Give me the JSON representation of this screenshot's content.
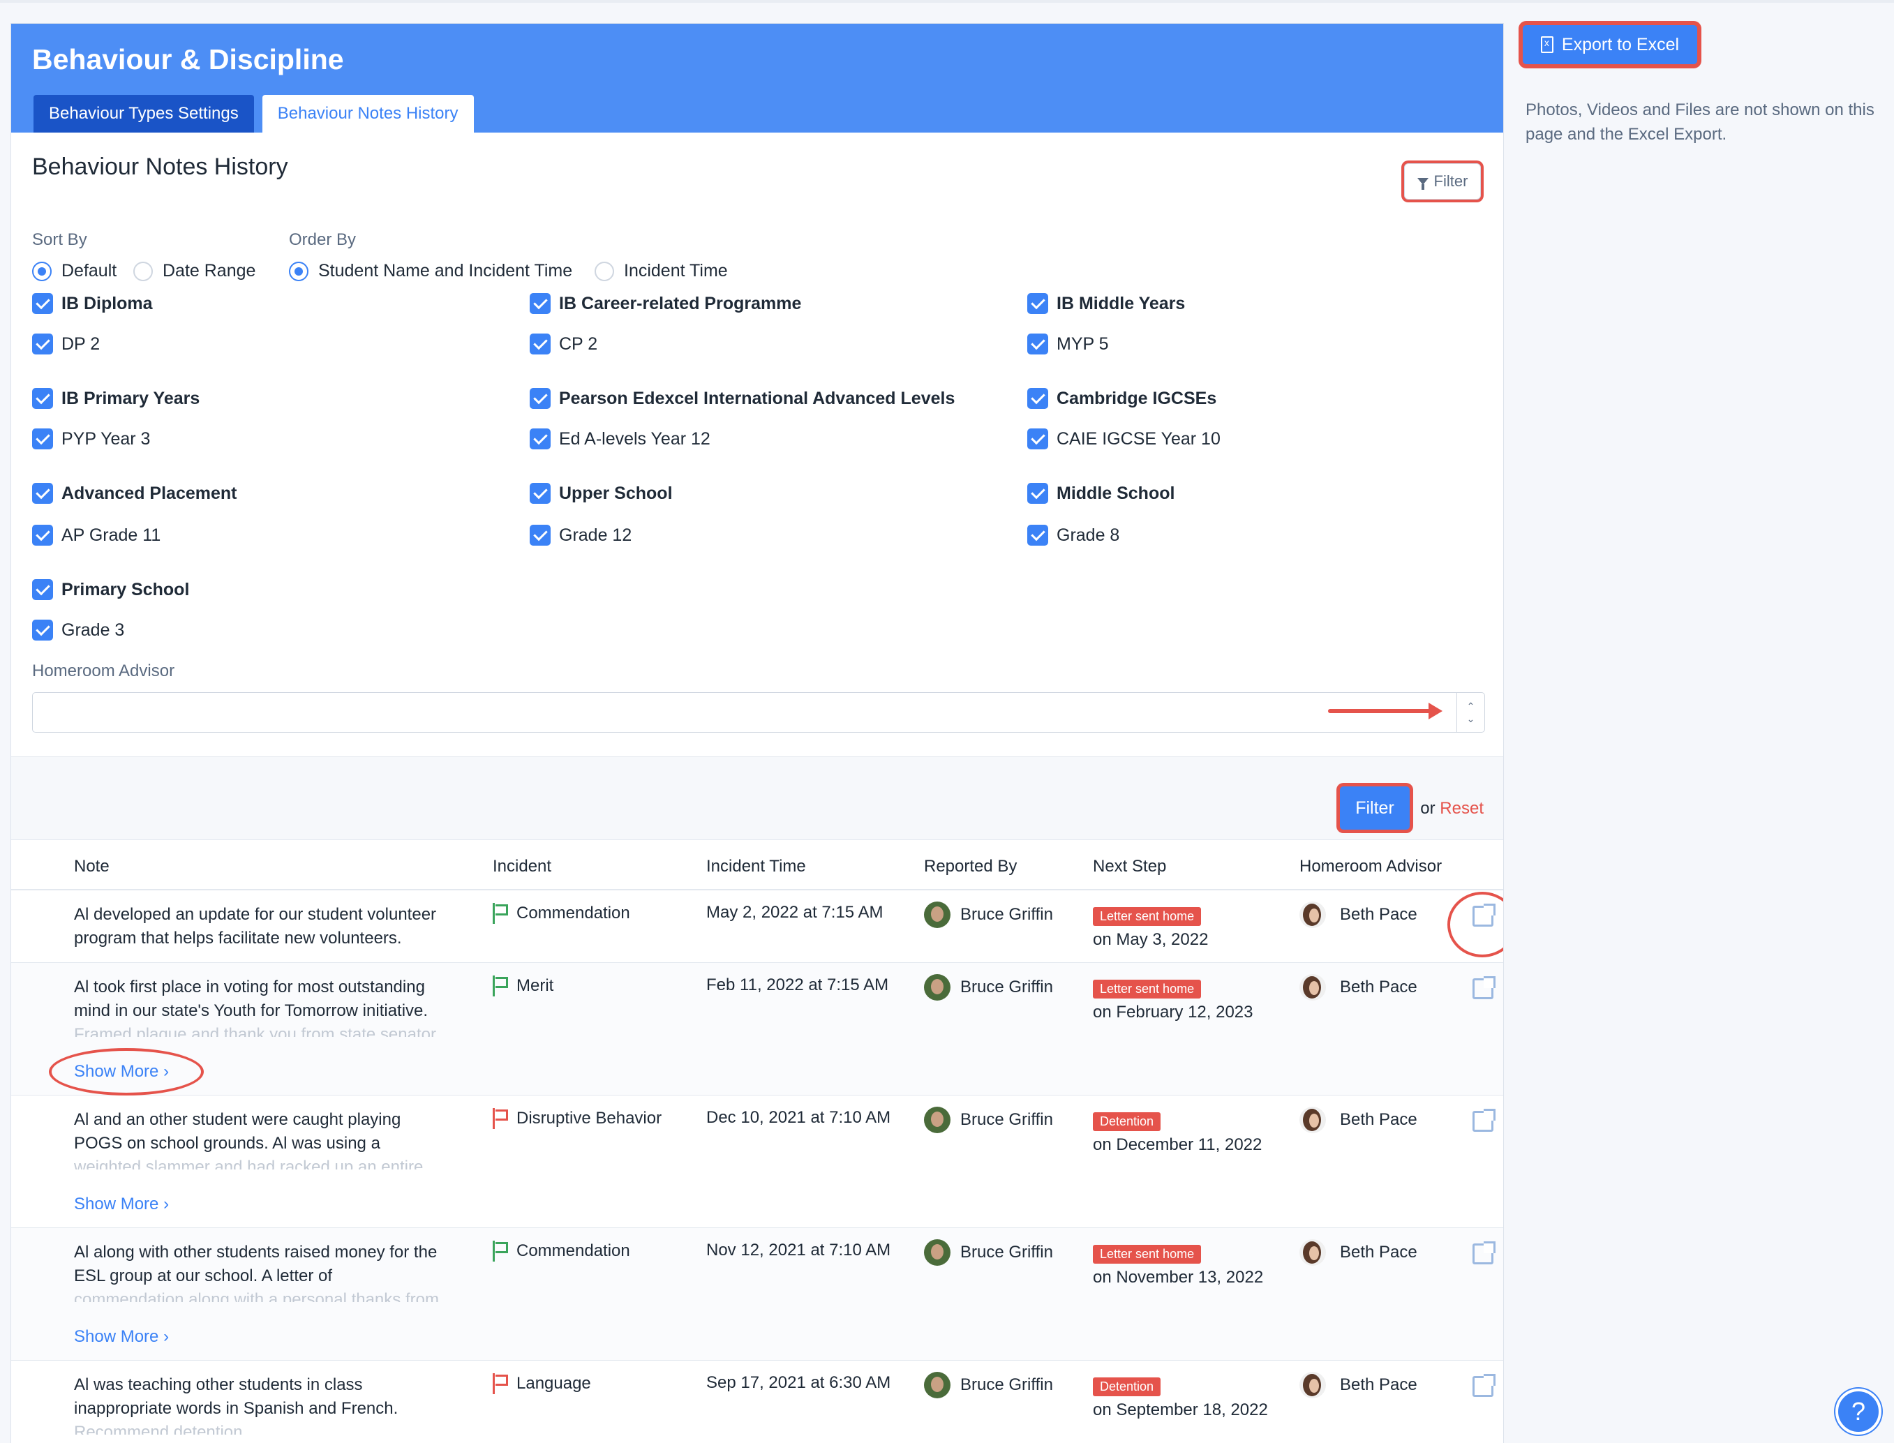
{
  "header": {
    "title": "Behaviour & Discipline",
    "tabs": [
      "Behaviour Types Settings",
      "Behaviour Notes History"
    ]
  },
  "page": {
    "section_title": "Behaviour Notes History",
    "filter_top_label": "Filter"
  },
  "sort_by": {
    "label": "Sort By",
    "options": [
      "Default",
      "Date Range"
    ],
    "selected": "Default"
  },
  "order_by": {
    "label": "Order By",
    "options": [
      "Student Name and Incident Time",
      "Incident Time"
    ],
    "selected": "Student Name and Incident Time"
  },
  "programmes": [
    {
      "name": "IB Diploma",
      "grade": "DP 2"
    },
    {
      "name": "IB Career-related Programme",
      "grade": "CP 2"
    },
    {
      "name": "IB Middle Years",
      "grade": "MYP 5"
    },
    {
      "name": "IB Primary Years",
      "grade": "PYP Year 3"
    },
    {
      "name": "Pearson Edexcel International Advanced Levels",
      "grade": "Ed A-levels Year 12"
    },
    {
      "name": "Cambridge IGCSEs",
      "grade": "CAIE IGCSE Year 10"
    },
    {
      "name": "Advanced Placement",
      "grade": "AP Grade 11"
    },
    {
      "name": "Upper School",
      "grade": "Grade 12"
    },
    {
      "name": "Middle School",
      "grade": "Grade 8"
    },
    {
      "name": "Primary School",
      "grade": "Grade 3"
    }
  ],
  "homeroom": {
    "label": "Homeroom Advisor",
    "value": ""
  },
  "actions": {
    "filter_label": "Filter",
    "or_text": "or",
    "reset_label": "Reset"
  },
  "table": {
    "columns": [
      "Note",
      "Incident",
      "Incident Time",
      "Reported By",
      "Next Step",
      "Homeroom Advisor"
    ],
    "show_more_label": "Show More",
    "rows": [
      {
        "note_lines": [
          "Al developed an update for our student volunteer",
          "program that helps facilitate new volunteers."
        ],
        "note_fade": "",
        "incident": "Commendation",
        "incident_color": "green",
        "time": "May 2, 2022 at 7:15 AM",
        "reported_by": "Bruce Griffin",
        "next_step": "Letter sent home",
        "next_date": "on May 3, 2022",
        "advisor": "Beth Pace",
        "show_more": false
      },
      {
        "note_lines": [
          "Al took first place in voting for most outstanding",
          "mind in our state's Youth for Tomorrow initiative."
        ],
        "note_fade": "Framed plaque and thank you from state senator.",
        "incident": "Merit",
        "incident_color": "green",
        "time": "Feb 11, 2022 at 7:15 AM",
        "reported_by": "Bruce Griffin",
        "next_step": "Letter sent home",
        "next_date": "on February 12, 2023",
        "advisor": "Beth Pace",
        "show_more": true
      },
      {
        "note_lines": [
          "Al and an other student were caught playing",
          "POGS on school grounds. Al was using a"
        ],
        "note_fade": "weighted slammer and had racked up an entire",
        "incident": "Disruptive Behavior",
        "incident_color": "red",
        "time": "Dec 10, 2021 at 7:10 AM",
        "reported_by": "Bruce Griffin",
        "next_step": "Detention",
        "next_date": "on December 11, 2022",
        "advisor": "Beth Pace",
        "show_more": true
      },
      {
        "note_lines": [
          "Al along with other students raised money for the",
          "ESL group at our school. A letter of"
        ],
        "note_fade": "commendation along with a personal thanks from",
        "incident": "Commendation",
        "incident_color": "green",
        "time": "Nov 12, 2021 at 7:10 AM",
        "reported_by": "Bruce Griffin",
        "next_step": "Letter sent home",
        "next_date": "on November 13, 2022",
        "advisor": "Beth Pace",
        "show_more": true
      },
      {
        "note_lines": [
          "Al was teaching other students in class",
          "inappropriate words in Spanish and French."
        ],
        "note_fade": "Recommend detention.",
        "incident": "Language",
        "incident_color": "red",
        "time": "Sep 17, 2021 at 6:30 AM",
        "reported_by": "Bruce Griffin",
        "next_step": "Detention",
        "next_date": "on September 18, 2022",
        "advisor": "Beth Pace",
        "show_more": true
      }
    ]
  },
  "sidebar": {
    "export_label": "Export to Excel",
    "note": "Photos, Videos and Files are not shown on this page and the Excel Export."
  },
  "colors": {
    "header_blue": "#4d8ef5",
    "active_blue": "#3b82f6",
    "dark_tab": "#1a54c7",
    "badge_red": "#e5534b",
    "annotation_red": "#e5534b"
  },
  "icons": [
    "filter-icon",
    "excel-file-icon",
    "flag-icon",
    "external-link-icon",
    "help-icon",
    "chevron-right-icon",
    "spinner-arrows-icon"
  ]
}
